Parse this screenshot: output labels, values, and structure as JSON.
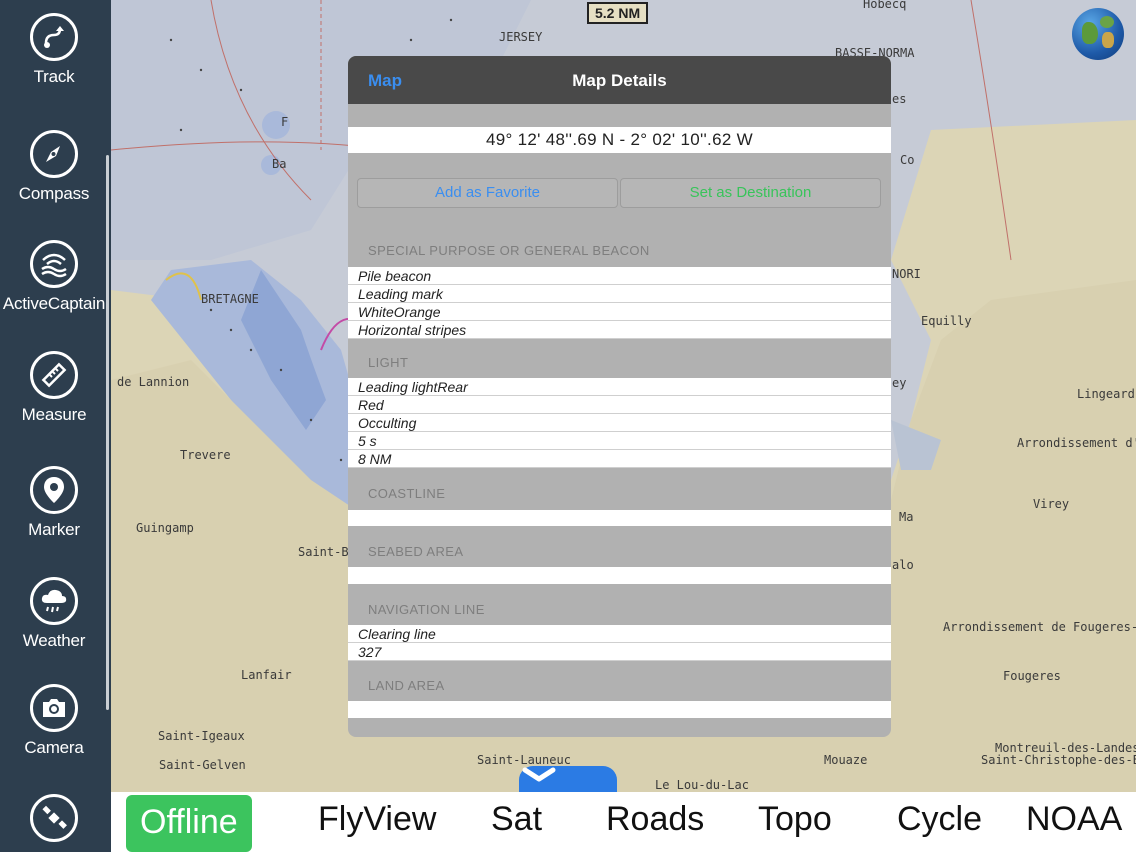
{
  "sidebar": {
    "items": [
      {
        "label": "Track",
        "icon": "track-icon"
      },
      {
        "label": "Compass",
        "icon": "compass-icon"
      },
      {
        "label": "ActiveCaptain",
        "icon": "activecaptain-icon"
      },
      {
        "label": "Measure",
        "icon": "ruler-icon"
      },
      {
        "label": "Marker",
        "icon": "map-pin-icon"
      },
      {
        "label": "Weather",
        "icon": "cloud-rain-icon"
      },
      {
        "label": "Camera",
        "icon": "camera-icon"
      },
      {
        "label": "",
        "icon": "satellite-icon"
      }
    ]
  },
  "map": {
    "scale": "5.2 NM",
    "places": [
      "JERSEY",
      "BASSE-NORMA",
      "BRETAGNE",
      "de Lannion",
      "Trevere",
      "Guingamp",
      "Saint-B",
      "Lanfair",
      "Saint-Igeaux",
      "Saint-Gelven",
      "Saint-Launeuc",
      "Le Lou-du-Lac",
      "Mouaze",
      "Equilly",
      "Lingeard",
      "Arrondissement d'A",
      "Virey",
      "Arrondissement de Fougeres-Vi",
      "Fougeres",
      "Montreuil-des-Landes",
      "Saint-Christophe-des-Bo",
      "Co",
      "es",
      "NORI",
      "ey",
      "Ma",
      "alo",
      "Hobecq",
      "Ba",
      "F"
    ]
  },
  "modal": {
    "back_label": "Map",
    "title": "Map Details",
    "coordinates": "49° 12' 48''.69 N  -  2° 02' 10''.62 W",
    "add_favorite": "Add as Favorite",
    "set_destination": "Set as Destination",
    "sections": {
      "beacon": {
        "title": "SPECIAL PURPOSE OR GENERAL BEACON",
        "rows": [
          "Pile beacon",
          "Leading mark",
          "WhiteOrange",
          "Horizontal stripes"
        ]
      },
      "light": {
        "title": "LIGHT",
        "rows": [
          "Leading lightRear",
          "Red",
          "Occulting",
          "5 s",
          "8 NM"
        ]
      },
      "coastline": {
        "title": "COASTLINE"
      },
      "seabed": {
        "title": "SEABED AREA"
      },
      "navline": {
        "title": "NAVIGATION LINE",
        "rows": [
          "Clearing line",
          " 327"
        ]
      },
      "landarea": {
        "title": "LAND AREA"
      }
    }
  },
  "bottom_bar": {
    "map_types": [
      "Offline",
      "FlyView",
      "Sat",
      "Roads",
      "Topo",
      "Cycle",
      "NOAA"
    ],
    "active": "Offline"
  },
  "colors": {
    "sidebar": "#2d3e4e",
    "accent_blue": "#3a8ef0",
    "accent_green": "#3cc45e"
  }
}
